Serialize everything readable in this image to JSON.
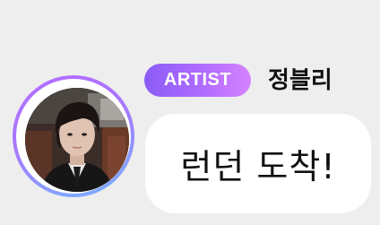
{
  "artist_badge": {
    "label": "ARTIST"
  },
  "sender": {
    "name": "정블리"
  },
  "message": {
    "text": "런던 도착!"
  },
  "colors": {
    "background": "#eeeeee",
    "badge_gradient_start": "#8b5cf6",
    "badge_gradient_end": "#d682ff",
    "ring_gradient_start": "#b56cff",
    "ring_gradient_end": "#74b6ff",
    "bubble": "#ffffff",
    "text": "#111111"
  },
  "icons": {
    "avatar": "profile-photo"
  }
}
